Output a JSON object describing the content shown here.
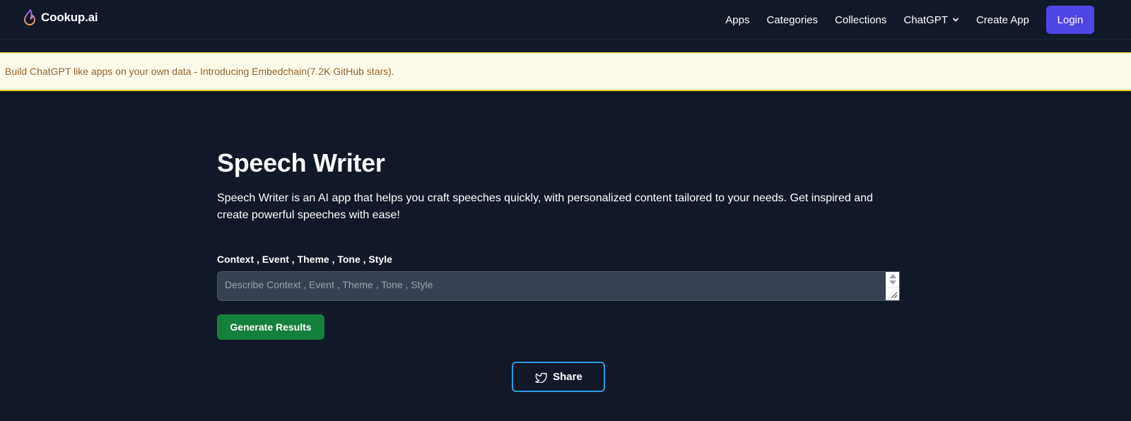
{
  "header": {
    "brand": "Cookup.ai",
    "nav": [
      {
        "label": "Apps"
      },
      {
        "label": "Categories"
      },
      {
        "label": "Collections"
      },
      {
        "label": "ChatGPT",
        "has_dropdown": true
      },
      {
        "label": "Create App"
      }
    ],
    "login_label": "Login"
  },
  "banner": {
    "text": "Build ChatGPT like apps on your own data - Introducing Embedchain(7.2K GitHub stars)."
  },
  "main": {
    "title": "Speech Writer",
    "description": "Speech Writer is an AI app that helps you craft speeches quickly, with personalized content tailored to your needs. Get inspired and create powerful speeches with ease!",
    "field_label": "Context , Event , Theme , Tone , Style",
    "field_value": "",
    "field_placeholder": "Describe Context , Event , Theme , Tone , Style",
    "generate_label": "Generate Results",
    "share_label": "Share"
  },
  "colors": {
    "background": "#111827",
    "accent": "#4f46e5",
    "generate": "#15803d",
    "share_border": "#2b9be6",
    "banner_bg": "#fffbeb",
    "banner_border": "#facc15",
    "banner_text": "#92622a"
  },
  "icons": {
    "logo": "flame-icon",
    "dropdown": "chevron-down-icon",
    "share": "twitter-icon"
  }
}
